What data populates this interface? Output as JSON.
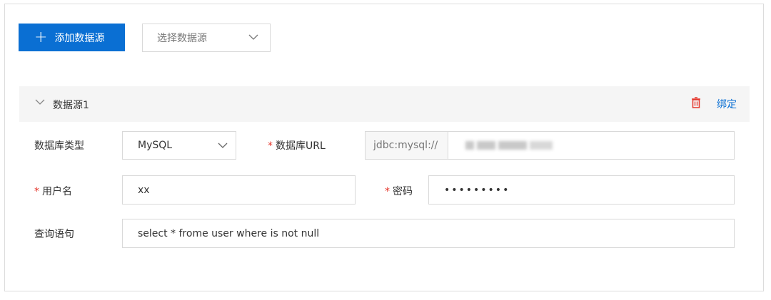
{
  "toolbar": {
    "add_label": "添加数据源",
    "select_placeholder": "选择数据源"
  },
  "panel": {
    "title": "数据源1",
    "bind_label": "绑定"
  },
  "form": {
    "db_type_label": "数据库类型",
    "db_type_value": "MySQL",
    "url_label": "数据库URL",
    "url_prefix": "jdbc:mysql://",
    "username_label": "用户名",
    "username_value": "xx",
    "password_label": "密码",
    "password_value": "•••••••••",
    "query_label": "查询语句",
    "query_value": "select * frome user where is not null"
  },
  "icons": {
    "add": "plus-icon",
    "dropdown": "chevron-down-icon",
    "collapse": "chevron-down-icon",
    "delete": "trash-icon"
  },
  "colors": {
    "primary": "#0a6fd3",
    "danger": "#e5362c",
    "header_bg": "#f5f5f5"
  }
}
